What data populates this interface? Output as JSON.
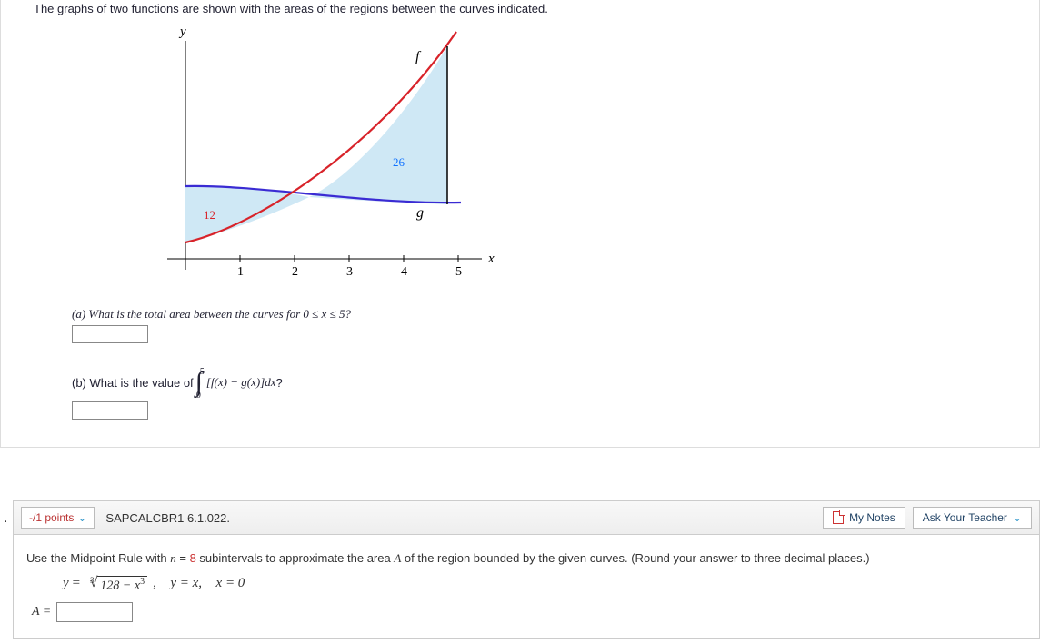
{
  "problem1": {
    "prompt": "The graphs of two functions are shown with the areas of the regions between the curves indicated.",
    "graph": {
      "yLabel": "y",
      "xLabel": "x",
      "fLabel": "f",
      "gLabel": "g",
      "area1": "12",
      "area2": "26",
      "ticks": [
        "1",
        "2",
        "3",
        "4",
        "5"
      ]
    },
    "partA": "(a) What is the total area between the curves for  0 ≤ x ≤ 5?",
    "partB_lead": "(b) What is the value of",
    "partB_upper": "5",
    "partB_lower": "0",
    "partB_integrand": "[f(x) − g(x)]dx",
    "partB_tail": "?"
  },
  "toolbar": {
    "points": "-/1 points",
    "qid": "SAPCALCBR1 6.1.022.",
    "notes": "My Notes",
    "ask": "Ask Your Teacher"
  },
  "problem2": {
    "lead": "Use the Midpoint Rule with ",
    "nEquals": "n",
    "equals": " = ",
    "nVal": "8",
    "mid": " subintervals to approximate the area ",
    "Avar": "A",
    "mid2": " of the region bounded by the given curves. (Round your answer to three decimal places.)",
    "eq_y": "y",
    "eq_eq": " = ",
    "radIndex": "3",
    "radBody_a": "128 − x",
    "radBody_sup": "3",
    "eq_sep": ",",
    "eq2": "y = x,",
    "eq3": "x = 0",
    "ansLabel": "A ="
  },
  "chart_data": {
    "type": "area",
    "title": "",
    "xlabel": "x",
    "ylabel": "y",
    "xlim": [
      0,
      5.5
    ],
    "series": [
      {
        "name": "f",
        "description": "increasing concave-up curve (red)"
      },
      {
        "name": "g",
        "description": "shallow concave-up curve (blue)"
      }
    ],
    "regions": [
      {
        "label": "12",
        "between": [
          "g",
          "f"
        ],
        "x_range": [
          0,
          2.5
        ],
        "color": "#c33"
      },
      {
        "label": "26",
        "between": [
          "f",
          "g"
        ],
        "x_range": [
          2.5,
          5
        ],
        "color": "#18f"
      }
    ],
    "x_ticks": [
      1,
      2,
      3,
      4,
      5
    ],
    "intersection_x": 2.5,
    "annotations": [
      {
        "text": "f",
        "x": 4.3,
        "y_rel": "high"
      },
      {
        "text": "g",
        "x": 4.2,
        "y_rel": "low"
      }
    ]
  }
}
